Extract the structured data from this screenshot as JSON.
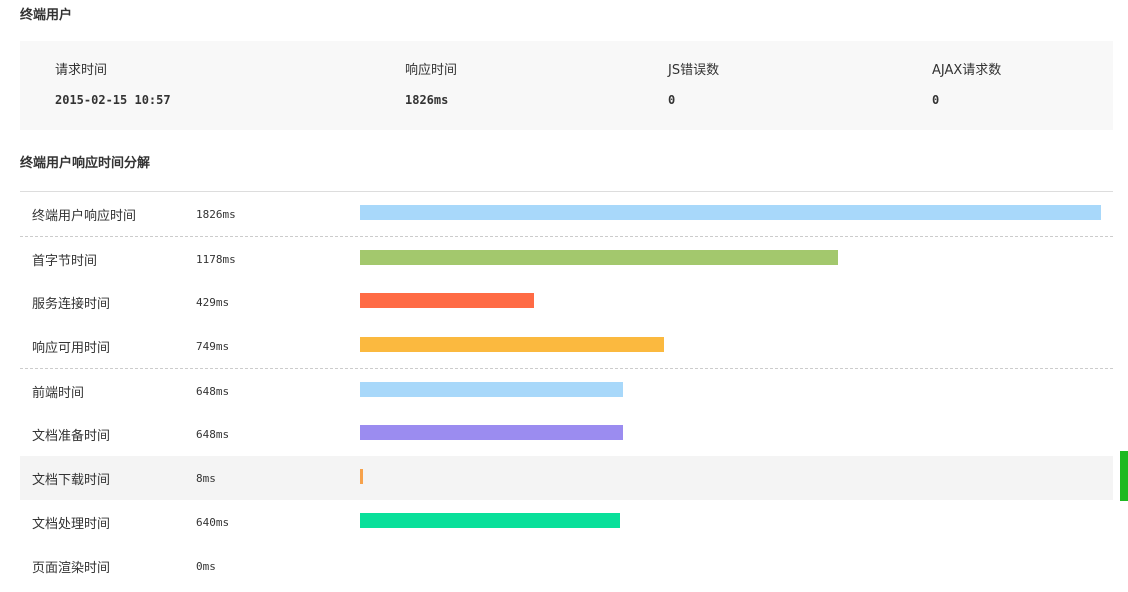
{
  "section1": {
    "title": "终端用户"
  },
  "summary": {
    "columns": [
      {
        "label": "请求时间",
        "value": "2015-02-15 10:57"
      },
      {
        "label": "响应时间",
        "value": "1826ms"
      },
      {
        "label": "JS错误数",
        "value": "0"
      },
      {
        "label": "AJAX请求数",
        "value": "0"
      }
    ]
  },
  "section2": {
    "title": "终端用户响应时间分解"
  },
  "breakdown": {
    "max_ms": 1826,
    "rows": [
      {
        "label": "终端用户响应时间",
        "value_text": "1826ms",
        "ms": 1826,
        "color": "#a8d8fa"
      },
      {
        "label": "首字节时间",
        "value_text": "1178ms",
        "ms": 1178,
        "color": "#a3c86d"
      },
      {
        "label": "服务连接时间",
        "value_text": "429ms",
        "ms": 429,
        "color": "#ff6b45"
      },
      {
        "label": "响应可用时间",
        "value_text": "749ms",
        "ms": 749,
        "color": "#fbb93f"
      },
      {
        "label": "前端时间",
        "value_text": "648ms",
        "ms": 648,
        "color": "#a8d8fa"
      },
      {
        "label": "文档准备时间",
        "value_text": "648ms",
        "ms": 648,
        "color": "#9b8cf0"
      },
      {
        "label": "文档下载时间",
        "value_text": "8ms",
        "ms": 8,
        "color": "#f7a24b"
      },
      {
        "label": "文档处理时间",
        "value_text": "640ms",
        "ms": 640,
        "color": "#08e09a"
      },
      {
        "label": "页面渲染时间",
        "value_text": "0ms",
        "ms": 0,
        "color": "#a8d8fa"
      }
    ]
  },
  "colors": {
    "scroll_indicator": "#1fb922",
    "panel_bg": "#f8f8f8"
  }
}
